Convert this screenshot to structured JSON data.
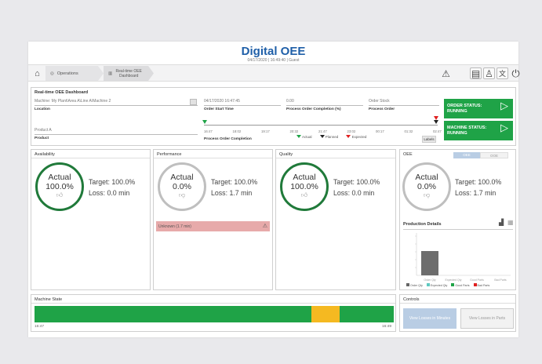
{
  "header": {
    "title": "Digital OEE",
    "subtitle": "04/17/2020 | 16:49:40 | Guest"
  },
  "nav": {
    "crumbs": [
      "Operations",
      "Real-time OEE Dashboard"
    ]
  },
  "dashboard": {
    "title": "Real-time OEE Dashboard",
    "machine_value": "Machine: My Plant\\Area A\\Line A\\Machine 2",
    "location_label": "Location",
    "start_value": "04/17/2020 16:47:45",
    "start_label": "Order Start Time",
    "completion_value": "0.00",
    "completion_label": "Process Order Completion (%)",
    "order_value": "Order Stock",
    "order_label": "Process Order",
    "product_value": "Product A",
    "product_label": "Product",
    "timeline_label": "Process Order Completion",
    "ticks": [
      "16:47",
      "18:02",
      "19:17",
      "20:32",
      "21:47",
      "23:02",
      "00:17",
      "01:32",
      "02:47"
    ],
    "legend": [
      "Actual",
      "Planned",
      "Expected"
    ],
    "labels_btn": "Labels",
    "order_status": [
      "ORDER STATUS:",
      "RUNNING"
    ],
    "machine_status": [
      "MACHINE STATUS:",
      "RUNNING"
    ]
  },
  "availability": {
    "title": "Availability",
    "actual": "Actual",
    "value": "100.0%",
    "target": "Target: 100.0%",
    "loss": "Loss: 0.0 min"
  },
  "performance": {
    "title": "Performance",
    "actual": "Actual",
    "value": "0.0%",
    "target": "Target: 100.0%",
    "loss": "Loss: 1.7 min",
    "unknown": "Unknown (1.7 min)"
  },
  "quality": {
    "title": "Quality",
    "actual": "Actual",
    "value": "100.0%",
    "target": "Target: 100.0%",
    "loss": "Loss: 0.0 min"
  },
  "oee": {
    "title": "OEE",
    "tab_a": "OEE",
    "tab_b": "OOE",
    "actual": "Actual",
    "value": "0.0%",
    "target": "Target: 100.0%",
    "loss": "Loss: 1.7 min"
  },
  "production": {
    "title": "Production Details",
    "categories": [
      "Order Qty",
      "Expected Qty",
      "Good Parts",
      "Bad Parts"
    ],
    "legend": [
      "Order Qty",
      "Expected Qty",
      "Good Parts",
      "Bad Parts"
    ],
    "colors": [
      "#666666",
      "#5fc9c0",
      "#1fa347",
      "#e02020"
    ]
  },
  "machine_state": {
    "title": "Machine State",
    "start": "16:47",
    "end": "16:49"
  },
  "controls": {
    "title": "Controls",
    "btn_minutes": "View Losses in Minutes",
    "btn_parts": "View Losses in Parts"
  },
  "colors": {
    "accent": "#1f5fa8",
    "green": "#1fa347",
    "amber": "#f5b921"
  }
}
